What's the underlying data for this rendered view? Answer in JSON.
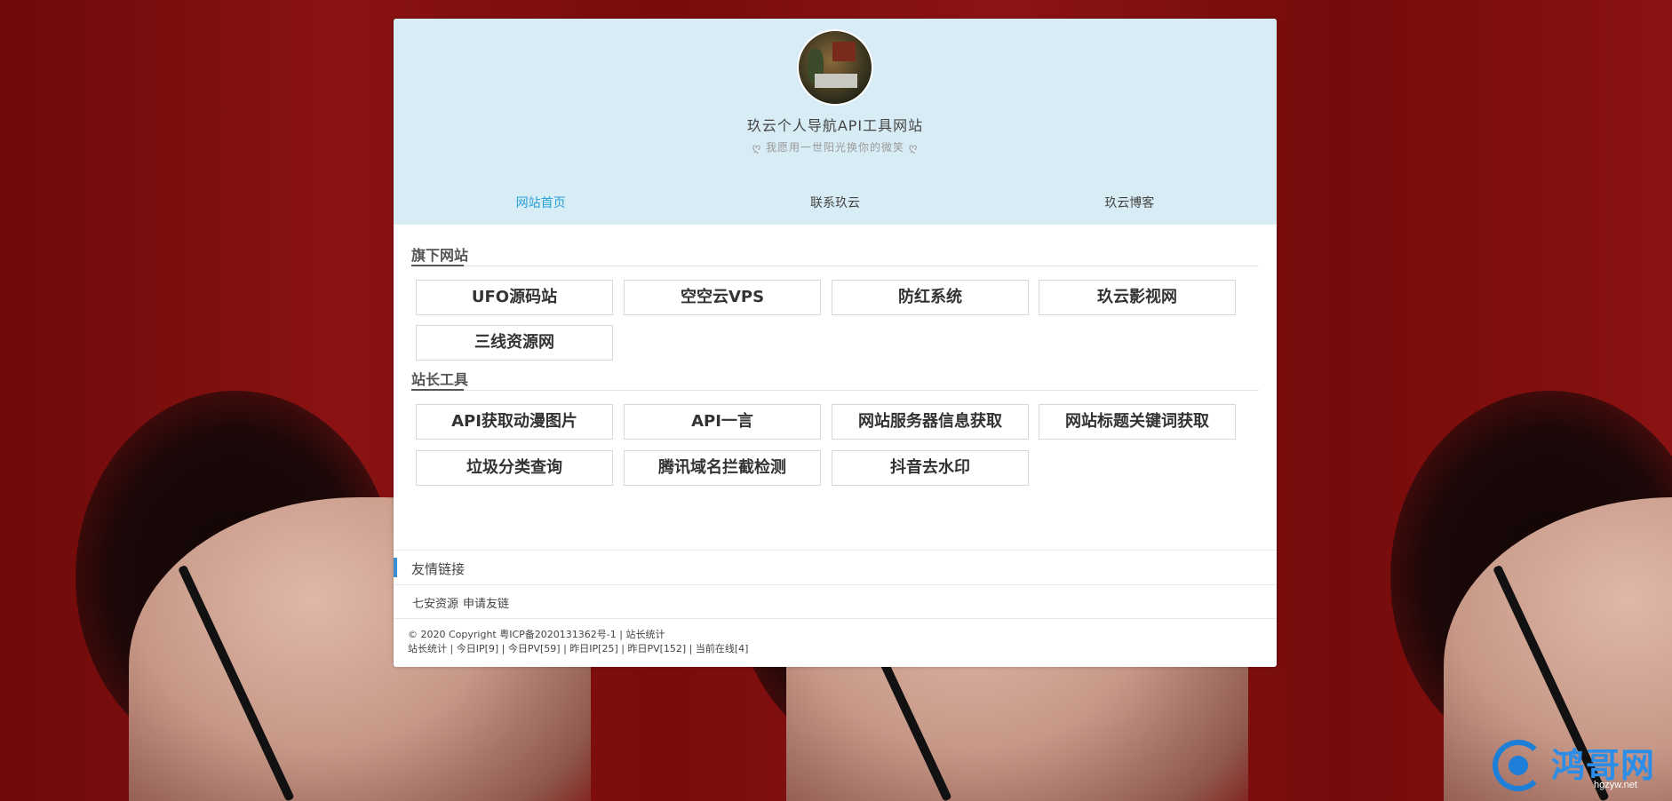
{
  "site": {
    "title": "玖云个人导航API工具网站",
    "motto": "ღ 我愿用一世阳光换你的微笑 ღ"
  },
  "nav": [
    {
      "label": "网站首页",
      "active": true
    },
    {
      "label": "联系玖云",
      "active": false
    },
    {
      "label": "玖云博客",
      "active": false
    }
  ],
  "sections": {
    "owned_sites": {
      "title": "旗下网站",
      "items": [
        "UFO源码站",
        "空空云VPS",
        "防红系统",
        "玖云影视网",
        "三线资源网"
      ]
    },
    "webmaster_tools": {
      "title": "站长工具",
      "items": [
        "API获取动漫图片",
        "API一言",
        "网站服务器信息获取",
        "网站标题关键词获取",
        "垃圾分类查询",
        "腾讯域名拦截检测",
        "抖音去水印"
      ]
    }
  },
  "friend_links": {
    "title": "友情链接",
    "items": [
      "七安资源",
      "申请友链"
    ]
  },
  "footer": {
    "line1": "© 2020 Copyright  粤ICP备2020131362号-1 |  站长统计",
    "line2": "站长统计 | 今日IP[9] | 今日PV[59] | 昨日IP[25] | 昨日PV[152] | 当前在线[4]"
  },
  "watermark": {
    "text": "鸿哥网",
    "sub": "hgzyw.net"
  },
  "colors": {
    "header_bg": "#d8ecf6",
    "nav_active": "#2aa1d6",
    "friend_accent": "#3a8fd0"
  }
}
